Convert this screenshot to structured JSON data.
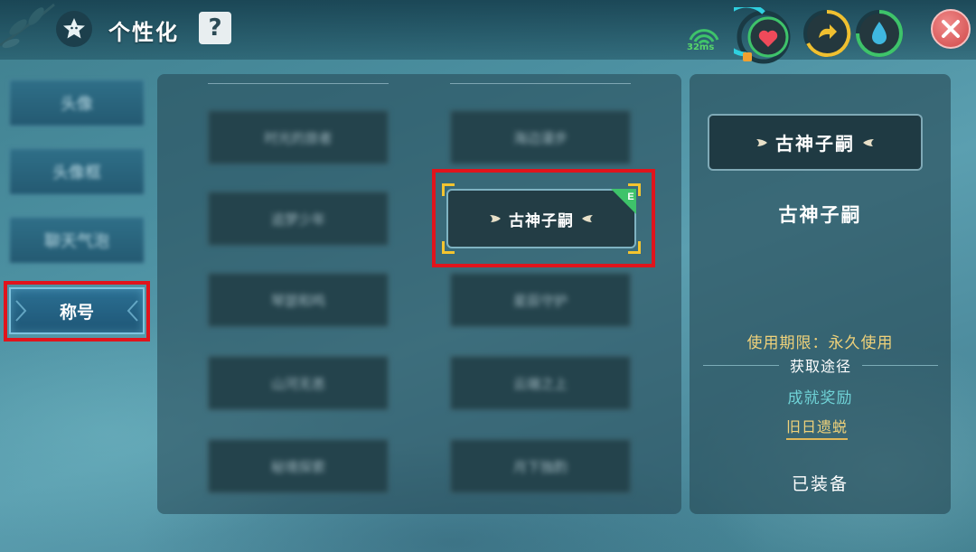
{
  "header": {
    "title": "个性化",
    "help_label": "?",
    "ping": "32ms"
  },
  "sidebar": {
    "tabs": [
      {
        "label": "头像",
        "state": "blurred"
      },
      {
        "label": "头像框",
        "state": "blurred"
      },
      {
        "label": "聊天气泡",
        "state": "blurred"
      },
      {
        "label": "称号",
        "state": "active"
      }
    ]
  },
  "grid": {
    "cells": [
      {
        "label": "时光的旅者"
      },
      {
        "label": "海边漫步"
      },
      {
        "label": "追梦少年"
      },
      {
        "label": "古神子嗣",
        "selected": true,
        "equipped": true
      },
      {
        "label": "琴瑟和鸣"
      },
      {
        "label": "星辰守护"
      },
      {
        "label": "山河无恙"
      },
      {
        "label": "云端之上"
      },
      {
        "label": "秘境探索"
      },
      {
        "label": "月下独酌"
      }
    ],
    "equip_badge": "E"
  },
  "detail": {
    "preview_title": "古神子嗣",
    "title_name": "古神子嗣",
    "validity": "使用期限：永久使用",
    "source_heading": "获取途径",
    "source_category": "成就奖励",
    "source_link": "旧日遗蜕",
    "status": "已装备"
  },
  "colors": {
    "highlight_red": "#e0141c",
    "gold": "#f0d27a",
    "teal": "#6fd2d6",
    "equip_green": "#3ec36a"
  }
}
